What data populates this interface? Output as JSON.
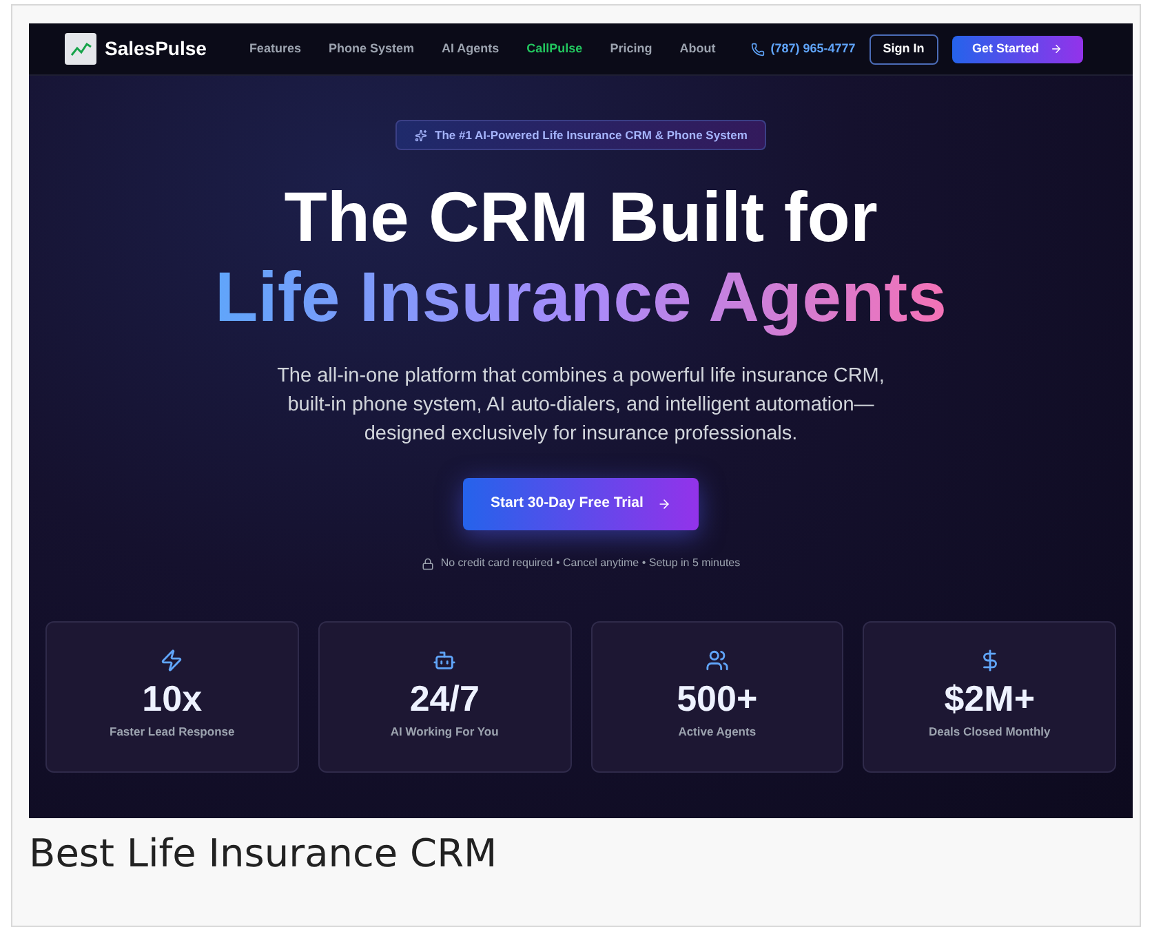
{
  "nav": {
    "brand": "SalesPulse",
    "links": [
      {
        "label": "Features",
        "selected": false
      },
      {
        "label": "Phone System",
        "selected": false
      },
      {
        "label": "AI Agents",
        "selected": false
      },
      {
        "label": "CallPulse",
        "selected": true
      },
      {
        "label": "Pricing",
        "selected": false
      },
      {
        "label": "About",
        "selected": false
      }
    ],
    "phone": "(787) 965-4777",
    "sign_in": "Sign In",
    "get_started": "Get Started"
  },
  "hero": {
    "badge": "The #1 AI-Powered Life Insurance CRM & Phone System",
    "title_line_1": "The CRM Built for",
    "title_line_2": "Life Insurance Agents",
    "description": "The all-in-one platform that combines a powerful life insurance CRM, built-in phone system, AI auto-dialers, and intelligent automation—designed exclusively for insurance professionals.",
    "cta": "Start 30-Day Free Trial",
    "note": "No credit card required • Cancel anytime • Setup in 5 minutes"
  },
  "stats": [
    {
      "value": "10x",
      "label": "Faster Lead Response"
    },
    {
      "value": "24/7",
      "label": "AI Working For You"
    },
    {
      "value": "500+",
      "label": "Active Agents"
    },
    {
      "value": "$2M+",
      "label": "Deals Closed Monthly"
    }
  ],
  "caption": "Best Life Insurance CRM"
}
